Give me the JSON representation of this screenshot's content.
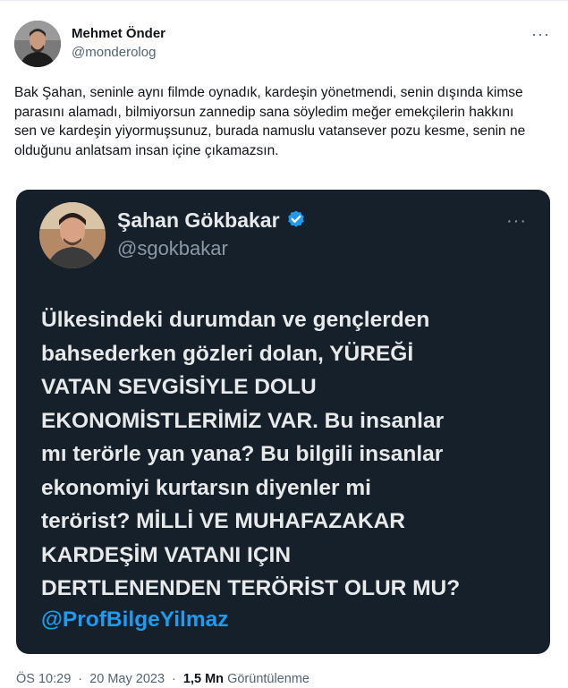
{
  "author": {
    "display_name": "Mehmet Önder",
    "handle": "@monderolog",
    "more_label": "···"
  },
  "tweet": {
    "text": "Bak Şahan, seninle aynı filmde oynadık, kardeşin yönetmendi, senin dışında kimse parasını alamadı, bilmiyorsun zannedip sana söyledim meğer emekçilerin hakkını sen ve kardeşin yiyormuşsunuz, burada namuslu vatansever pozu kesme, senin ne olduğunu anlatsam insan içine çıkamazsın."
  },
  "embedded": {
    "display_name": "Şahan Gökbakar",
    "handle": "@sgokbakar",
    "more_label": "···",
    "verified_color": "#1d9bf0",
    "text_lines": [
      "Ülkesindeki durumdan ve gençlerden",
      "bahsederken gözleri dolan, YÜREĞİ",
      "VATAN SEVGİSİYLE DOLU",
      "EKONOMİSTLERİMİZ VAR. Bu insanlar",
      "mı terörle yan yana? Bu bilgili insanlar",
      "ekonomiyi kurtarsın diyenler mi",
      "terörist? MİLLİ VE MUHAFAZAKAR",
      "KARDEŞİM VATANI IÇIN",
      "DERTLENENDEN TERÖRİST OLUR MU?"
    ],
    "mention": "@ProfBilgeYilmaz",
    "background": "#15202b"
  },
  "meta": {
    "time": "ÖS 10:29",
    "separator": "·",
    "date": "20 May 2023",
    "views_count": "1,5 Mn",
    "views_label": "Görüntülenme"
  }
}
